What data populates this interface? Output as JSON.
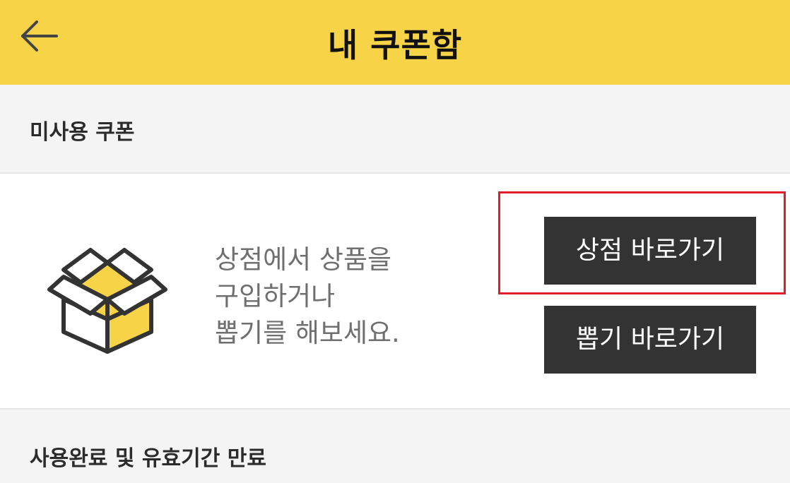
{
  "header": {
    "title": "내 쿠폰함",
    "back_icon": "arrow-left-icon",
    "background_color": "#f7d447"
  },
  "unused_section": {
    "label": "미사용 쿠폰"
  },
  "empty_state": {
    "icon": "open-box-icon",
    "message_lines": [
      "상점에서 상품을",
      "구입하거나",
      "뽑기를 해보세요."
    ],
    "accent_color": "#f7d447"
  },
  "buttons": {
    "shop_label": "상점 바로가기",
    "draw_label": "뽑기 바로가기",
    "button_color": "#333333",
    "highlight_color": "#e01e2b"
  },
  "used_section": {
    "label": "사용완료 및 유효기간 만료"
  }
}
